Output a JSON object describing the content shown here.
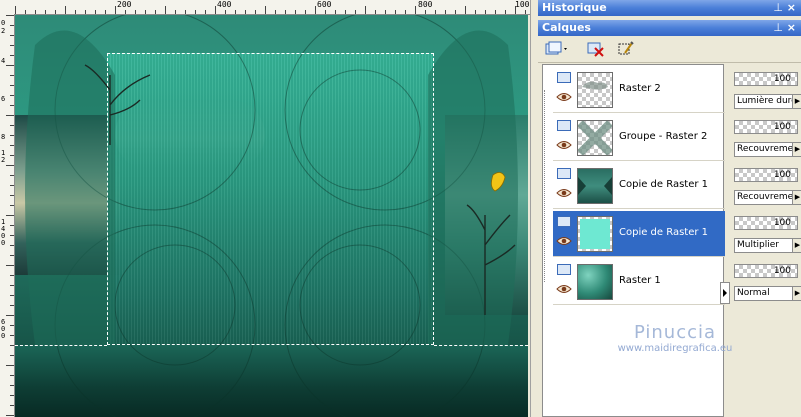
{
  "rulers": {
    "top_labels": [
      "200",
      "400",
      "600",
      "800",
      "100"
    ],
    "left_labels": [
      "0",
      "2",
      "4",
      "6",
      "8",
      "1",
      "2",
      "1",
      "4",
      "0",
      "0",
      "6",
      "0",
      "0"
    ]
  },
  "panels": {
    "history_title": "Historique",
    "layers_title": "Calques"
  },
  "layers": [
    {
      "name": "Raster 2",
      "opacity": "100",
      "opacity_fraction": 1.0,
      "blend": "Lumière dure",
      "selected": false
    },
    {
      "name": "Groupe - Raster 2",
      "opacity": "100",
      "opacity_fraction": 1.0,
      "blend": "Recouvrement",
      "selected": false
    },
    {
      "name": "Copie de Raster 1",
      "opacity": "100",
      "opacity_fraction": 1.0,
      "blend": "Recouvrement",
      "selected": false
    },
    {
      "name": "Copie de Raster 1",
      "opacity": "100",
      "opacity_fraction": 1.0,
      "blend": "Multiplier",
      "selected": true
    },
    {
      "name": "Raster 1",
      "opacity": "100",
      "opacity_fraction": 1.0,
      "blend": "Normal",
      "selected": false
    }
  ],
  "watermark": {
    "name": "Pinuccia",
    "url": "www.maidiregrafica.eu"
  },
  "colors": {
    "title_bar": "#4a7fd8",
    "selected_row": "#316ac5",
    "canvas_teal": "#2d9a82"
  }
}
